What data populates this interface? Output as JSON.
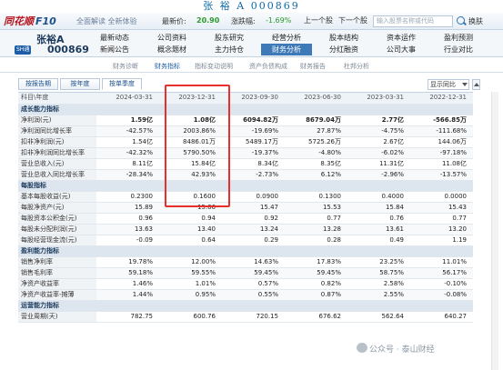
{
  "title": "张 裕 A 000869",
  "header": {
    "logo_text": "同花顺",
    "logo_suffix": "F10",
    "subtitle": "全面解读 全新体验",
    "latest_price_label": "最新价:",
    "latest_price": "20.90",
    "change_label": "涨跌幅:",
    "change_value": "-1.69%",
    "prev_btn": "上一个股",
    "next_btn": "下一个股",
    "search_placeholder": "输入股票名称或代码",
    "switch_label": "换肤"
  },
  "company": {
    "name": "张裕A",
    "badge": "SH通",
    "code": "000869"
  },
  "nav": {
    "items": [
      "最新动态",
      "公司资料",
      "股东研究",
      "经营分析",
      "股本结构",
      "资本运作",
      "盈利预测",
      "新闻公告",
      "概念题材",
      "主力持仓",
      "财务分析",
      "分红融资",
      "公司大事",
      "行业对比"
    ],
    "active_index": 10
  },
  "subtabs": {
    "items": [
      "财务诊断",
      "财务指标",
      "指标变动说明",
      "资产负债构成",
      "财务报告",
      "杜邦分析"
    ],
    "active_index": 1
  },
  "report_tabs": {
    "items": [
      "按报告期",
      "按年度",
      "按单季度"
    ],
    "active_index": 2,
    "compare_label": "显示同比"
  },
  "table": {
    "header": [
      "科目\\年度",
      "2024-03-31",
      "2023-12-31",
      "2023-09-30",
      "2023-06-30",
      "2023-03-31",
      "2022-12-31"
    ],
    "sections": [
      {
        "title": "成长能力指标",
        "rows": [
          {
            "label": "净利润(元)",
            "values": [
              "1.59亿",
              "1.08亿",
              "6094.82万",
              "8679.04万",
              "2.77亿",
              "-566.85万"
            ],
            "bold": true
          },
          {
            "label": "净利润同比增长率",
            "values": [
              "-42.57%",
              "2003.86%",
              "-19.69%",
              "27.87%",
              "-4.75%",
              "-111.68%"
            ]
          },
          {
            "label": "扣非净利润(元)",
            "values": [
              "1.54亿",
              "8486.01万",
              "5489.17万",
              "5725.26万",
              "2.67亿",
              "144.06万"
            ]
          },
          {
            "label": "扣非净利润同比增长率",
            "values": [
              "-42.32%",
              "5790.50%",
              "-19.37%",
              "-4.80%",
              "-6.02%",
              "-97.18%"
            ]
          },
          {
            "label": "营业总收入(元)",
            "values": [
              "8.11亿",
              "15.84亿",
              "8.34亿",
              "8.35亿",
              "11.31亿",
              "11.08亿"
            ]
          },
          {
            "label": "营业总收入同比增长率",
            "values": [
              "-28.34%",
              "42.93%",
              "-2.73%",
              "6.12%",
              "-2.96%",
              "-13.57%"
            ]
          }
        ]
      },
      {
        "title": "每股指标",
        "rows": [
          {
            "label": "基本每股收益(元)",
            "values": [
              "0.2300",
              "0.1600",
              "0.0900",
              "0.1300",
              "0.4000",
              "0.0000"
            ]
          },
          {
            "label": "每股净资产(元)",
            "values": [
              "15.89",
              "15.66",
              "15.47",
              "15.53",
              "15.84",
              "15.43"
            ]
          },
          {
            "label": "每股资本公积金(元)",
            "values": [
              "0.96",
              "0.94",
              "0.92",
              "0.77",
              "0.76",
              "0.77"
            ]
          },
          {
            "label": "每股未分配利润(元)",
            "values": [
              "13.63",
              "13.40",
              "13.24",
              "13.28",
              "13.61",
              "13.20"
            ]
          },
          {
            "label": "每股经营现金流(元)",
            "values": [
              "-0.09",
              "0.64",
              "0.29",
              "0.28",
              "0.49",
              "1.19"
            ]
          }
        ]
      },
      {
        "title": "盈利能力指标",
        "rows": [
          {
            "label": "销售净利率",
            "values": [
              "19.78%",
              "12.00%",
              "14.63%",
              "17.83%",
              "23.25%",
              "11.01%"
            ]
          },
          {
            "label": "销售毛利率",
            "values": [
              "59.18%",
              "59.55%",
              "59.45%",
              "59.45%",
              "58.75%",
              "56.17%"
            ]
          },
          {
            "label": "净资产收益率",
            "values": [
              "1.46%",
              "1.01%",
              "0.57%",
              "0.82%",
              "2.58%",
              "-0.10%"
            ]
          },
          {
            "label": "净资产收益率-摊薄",
            "values": [
              "1.44%",
              "0.95%",
              "0.55%",
              "0.87%",
              "2.55%",
              "-0.08%"
            ]
          }
        ]
      },
      {
        "title": "运营能力指标",
        "rows": [
          {
            "label": "营业周期(天)",
            "values": [
              "782.75",
              "600.76",
              "720.15",
              "676.62",
              "562.64",
              "640.27"
            ]
          }
        ]
      }
    ]
  },
  "watermark": "公众号 · 泰山财经"
}
